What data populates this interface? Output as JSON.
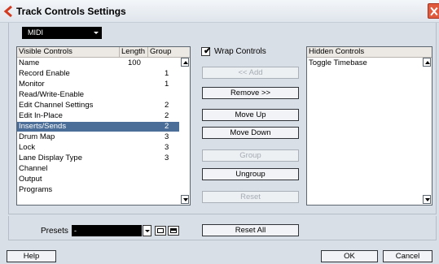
{
  "window": {
    "title": "Track Controls Settings",
    "app_icon": "cubase-logo-icon",
    "close_icon": "close-icon"
  },
  "track_type": {
    "selected": "MIDI"
  },
  "visible_controls": {
    "headers": [
      "Visible Controls",
      "Length",
      "Group"
    ],
    "rows": [
      {
        "name": "Name",
        "length": "100",
        "group": ""
      },
      {
        "name": "Record Enable",
        "length": "",
        "group": "1"
      },
      {
        "name": "Monitor",
        "length": "",
        "group": "1"
      },
      {
        "name": "Read/Write-Enable",
        "length": "",
        "group": ""
      },
      {
        "name": "Edit Channel Settings",
        "length": "",
        "group": "2"
      },
      {
        "name": "Edit In-Place",
        "length": "",
        "group": "2"
      },
      {
        "name": "Inserts/Sends",
        "length": "",
        "group": "2"
      },
      {
        "name": "Drum Map",
        "length": "",
        "group": "3"
      },
      {
        "name": "Lock",
        "length": "",
        "group": "3"
      },
      {
        "name": "Lane Display Type",
        "length": "",
        "group": "3"
      },
      {
        "name": "Channel",
        "length": "",
        "group": ""
      },
      {
        "name": "Output",
        "length": "",
        "group": ""
      },
      {
        "name": "Programs",
        "length": "",
        "group": ""
      }
    ],
    "selected_index": 6
  },
  "wrap_controls": {
    "label": "Wrap Controls",
    "checked": true,
    "check_mark": "✔"
  },
  "buttons": {
    "add": "<< Add",
    "remove": "Remove >>",
    "move_up": "Move Up",
    "move_down": "Move Down",
    "group": "Group",
    "ungroup": "Ungroup",
    "reset": "Reset",
    "reset_all": "Reset All",
    "help": "Help",
    "ok": "OK",
    "cancel": "Cancel"
  },
  "hidden_controls": {
    "header": "Hidden Controls",
    "rows": [
      "Toggle Timebase"
    ]
  },
  "presets": {
    "label": "Presets",
    "value": "-"
  },
  "colors": {
    "selection": "#4a6e97",
    "dialog_bg": "#d9dfe6",
    "close_button": "#e05a3d"
  }
}
